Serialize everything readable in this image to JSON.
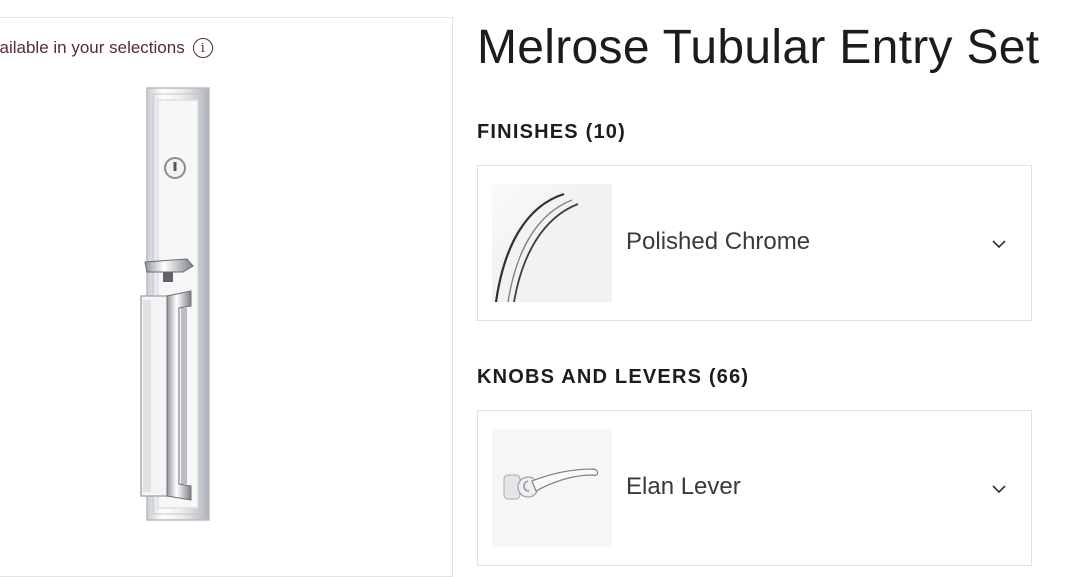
{
  "availability": {
    "text": "vailable in your selections",
    "info_glyph": "i"
  },
  "product": {
    "title": "Melrose Tubular Entry Set"
  },
  "finishes": {
    "heading": "FINISHES (10)",
    "selected": "Polished Chrome",
    "thumb_icon": "polished-chrome-swatch-icon"
  },
  "knobs_levers": {
    "heading": "KNOBS AND LEVERS (66)",
    "selected": "Elan Lever",
    "thumb_icon": "elan-lever-icon"
  },
  "colors": {
    "availability_text": "#5a2a32",
    "border": "#e0e0e0"
  }
}
